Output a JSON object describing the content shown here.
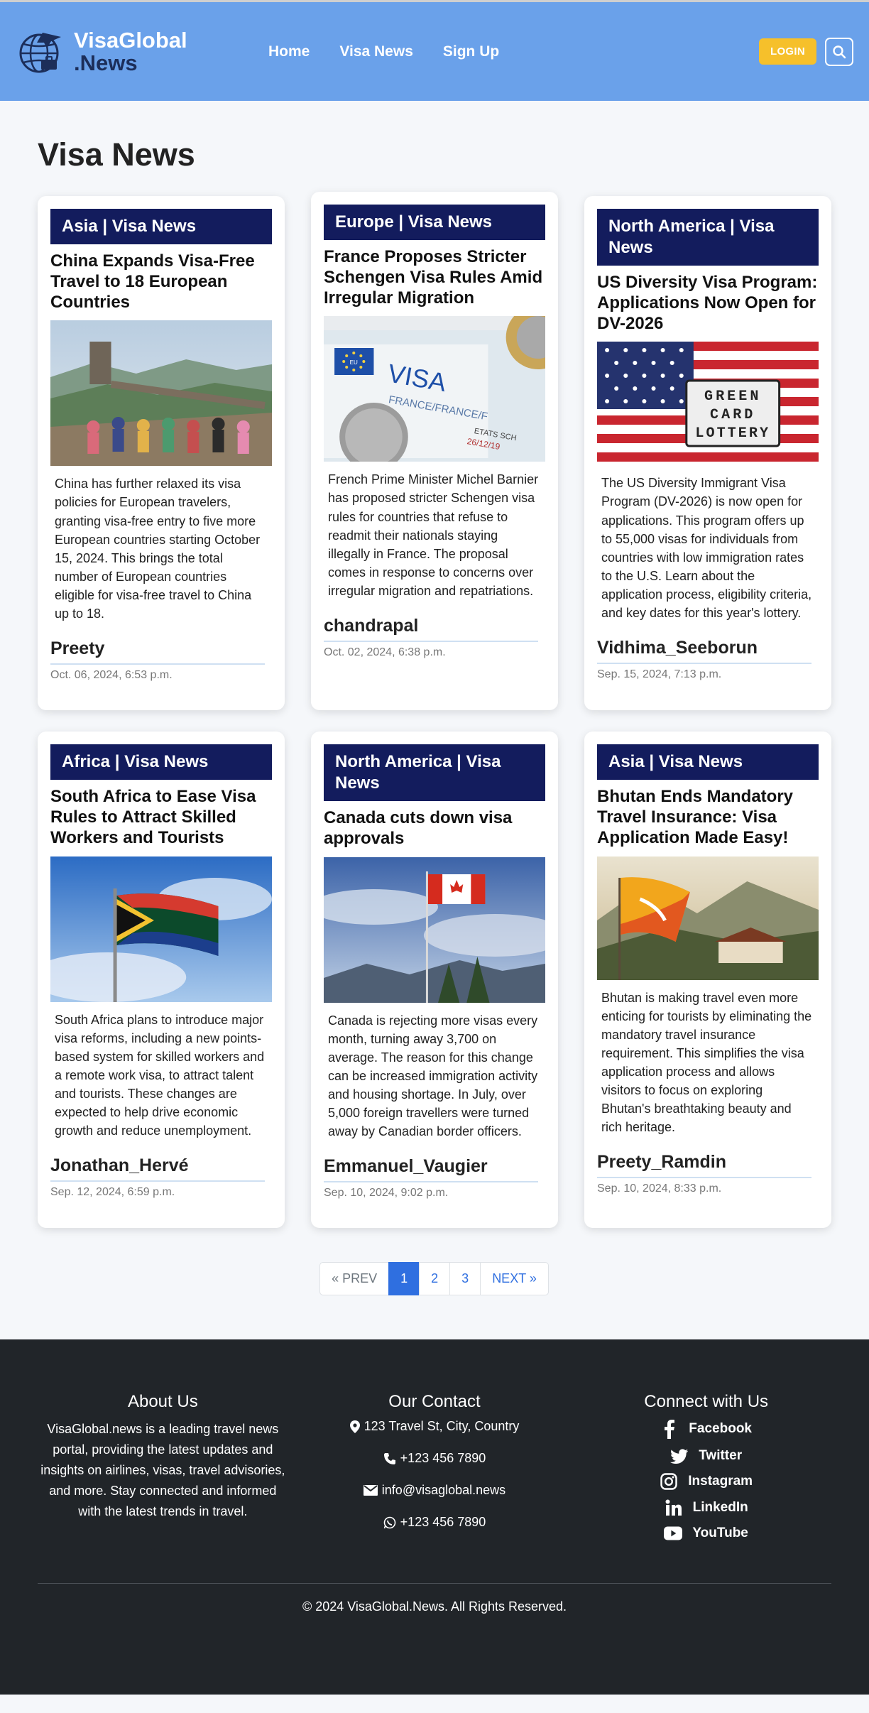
{
  "header": {
    "brand_line1": "VisaGlobal",
    "brand_line2": ".News",
    "nav": [
      "Home",
      "Visa News",
      "Sign Up"
    ],
    "login_label": "LOGIN"
  },
  "page_title": "Visa News",
  "articles": [
    {
      "category": "Asia | Visa News",
      "title": "China Expands Visa-Free Travel to 18 European Countries",
      "description": "China has further relaxed its visa policies for European travelers, granting visa-free entry to five more European countries starting October 15, 2024. This brings the total number of European countries eligible for visa-free travel to China up to 18.",
      "author": "Preety",
      "date": "Oct. 06, 2024, 6:53 p.m."
    },
    {
      "category": "Europe | Visa News",
      "title": "France Proposes Stricter Schengen Visa Rules Amid Irregular Migration",
      "description": "French Prime Minister Michel Barnier has proposed stricter Schengen visa rules for countries that refuse to readmit their nationals staying illegally in France. The proposal comes in response to concerns over irregular migration and repatriations.",
      "author": "chandrapal",
      "date": "Oct. 02, 2024, 6:38 p.m.",
      "image_text": [
        "VISA",
        "FRANCE/FRANCE/F",
        "ETATS SCH",
        "26/12/19"
      ]
    },
    {
      "category": "North America | Visa News",
      "title": "US Diversity Visa Program: Applications Now Open for DV-2026",
      "description": "The US Diversity Immigrant Visa Program (DV-2026) is now open for applications. This program offers up to 55,000 visas for individuals from countries with low immigration rates to the U.S. Learn about the application process, eligibility criteria, and key dates for this year's lottery.",
      "author": "Vidhima_Seeborun",
      "date": "Sep. 15, 2024, 7:13 p.m.",
      "image_text": [
        "GREEN",
        "CARD",
        "LOTTERY"
      ]
    },
    {
      "category": "Africa | Visa News",
      "title": "South Africa to Ease Visa Rules to Attract Skilled Workers and Tourists",
      "description": "South Africa plans to introduce major visa reforms, including a new points-based system for skilled workers and a remote work visa, to attract talent and tourists. These changes are expected to help drive economic growth and reduce unemployment.",
      "author": "Jonathan_Hervé",
      "date": "Sep. 12, 2024, 6:59 p.m."
    },
    {
      "category": "North America | Visa News",
      "title": "Canada cuts down visa approvals",
      "description": "Canada is rejecting more visas every month, turning away 3,700 on average. The reason for this change can be increased immigration activity and housing shortage. In July, over 5,000 foreign travellers were turned away by Canadian border officers.",
      "author": "Emmanuel_Vaugier",
      "date": "Sep. 10, 2024, 9:02 p.m."
    },
    {
      "category": "Asia | Visa News",
      "title": "Bhutan Ends Mandatory Travel Insurance: Visa Application Made Easy!",
      "description": "Bhutan is making travel even more enticing for tourists by eliminating the mandatory travel insurance requirement. This simplifies the visa application process and allows visitors to focus on exploring Bhutan's breathtaking beauty and rich heritage.",
      "author": "Preety_Ramdin",
      "date": "Sep. 10, 2024, 8:33 p.m."
    }
  ],
  "pagination": {
    "prev": "« PREV",
    "pages": [
      "1",
      "2",
      "3"
    ],
    "next": "NEXT »",
    "current": "1"
  },
  "footer": {
    "about_title": "About Us",
    "about_text": "VisaGlobal.news is a leading travel news portal, providing the latest updates and insights on airlines, visas, travel advisories, and more. Stay connected and informed with the latest trends in travel.",
    "contact_title": "Our Contact",
    "address": "123 Travel St, City, Country",
    "phone": "+123 456 7890",
    "email": "info@visaglobal.news",
    "whatsapp": "+123 456 7890",
    "social_title": "Connect with Us",
    "social": [
      "Facebook",
      "Twitter",
      "Instagram",
      "LinkedIn",
      "YouTube"
    ],
    "copyright": "© 2024 VisaGlobal.News. All Rights Reserved."
  },
  "colors": {
    "header_bg": "#6aa1ea",
    "category_bg": "#131c5d",
    "login_bg": "#f6c02b",
    "footer_bg": "#212529",
    "accent": "#2f6fe0"
  }
}
